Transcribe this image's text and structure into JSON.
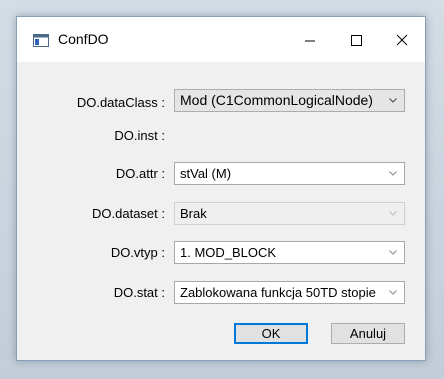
{
  "window": {
    "title": "ConfDO",
    "icon": "window-app-icon",
    "caption_buttons": [
      "minimize-icon",
      "maximize-icon",
      "close-icon"
    ]
  },
  "form": {
    "dataClass": {
      "label": "DO.dataClass :",
      "value": "Mod (C1CommonLogicalNode)"
    },
    "inst": {
      "label": "DO.inst :"
    },
    "attr": {
      "label": "DO.attr :",
      "value": "stVal (M)"
    },
    "dataset": {
      "label": "DO.dataset :",
      "value": "Brak"
    },
    "vtyp": {
      "label": "DO.vtyp :",
      "value": "1. MOD_BLOCK"
    },
    "stat": {
      "label": "DO.stat :",
      "value": "Zablokowana funkcja 50TD stopie"
    }
  },
  "buttons": {
    "ok": "OK",
    "cancel": "Anuluj"
  },
  "colors": {
    "accent": "#0078d7",
    "window_bg": "#f0f0f0",
    "titlebar_bg": "#ffffff"
  }
}
